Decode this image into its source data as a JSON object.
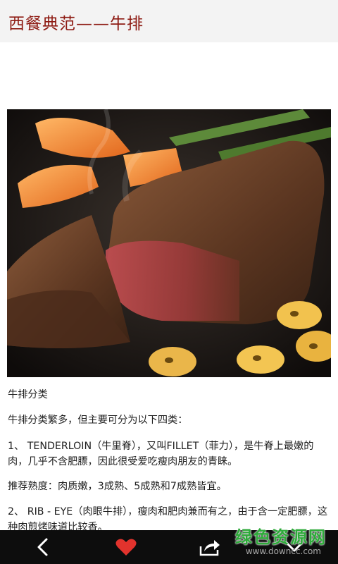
{
  "header": {
    "title": "西餐典范——牛排"
  },
  "hero_image": {
    "alt_icon": "steak-photo"
  },
  "article": {
    "paragraphs": [
      "牛排分类",
      "牛排分类繁多，但主要可分为以下四类：",
      "1、 TENDERLOIN（牛里脊），又叫FILLET（菲力），是牛脊上最嫩的肉，几乎不含肥膘，因此很受爱吃瘦肉朋友的青睐。",
      "推荐熟度：肉质嫩，3成熟、5成熟和7成熟皆宜。",
      "2、 RIB - EYE（肉眼牛排），瘦肉和肥肉兼而有之，由于含一定肥膘，这种肉煎烤味道比较香。"
    ]
  },
  "toolbar": {
    "back_icon": "chevron-left-icon",
    "favorite_icon": "heart-icon",
    "share_icon": "share-icon",
    "more_icon": "chevron-down-icon"
  },
  "watermark": {
    "main": "绿色资源网",
    "sub": "www.downcc.com"
  },
  "colors": {
    "title": "#8d1a12",
    "heart": "#e2332d",
    "watermark": "#2eaa3a"
  }
}
